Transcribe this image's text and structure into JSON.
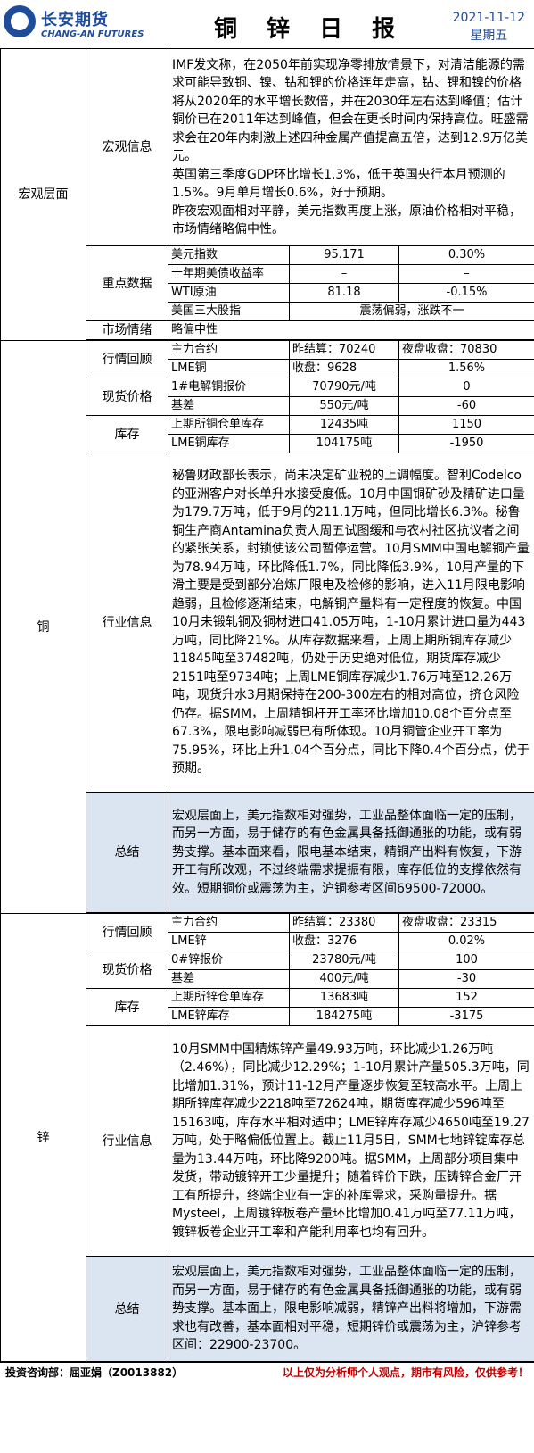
{
  "header": {
    "logo_cn": "长安期货",
    "logo_en": "CHANG-AN FUTURES",
    "title": "铜 锌 日 报",
    "date": "2021-11-12",
    "weekday": "星期五"
  },
  "macro": {
    "category": "宏观层面",
    "info_label": "宏观信息",
    "info_p1": "IMF发文称，在2050年前实现净零排放情景下，对清洁能源的需求可能导致铜、镍、钴和锂的价格连年走高，钴、锂和镍的价格将从2020年的水平增长数倍，并在2030年左右达到峰值；估计铜价已在2011年达到峰值，但会在更长时间内保持高位。旺盛需求会在20年内刺激上述四种金属产值提高五倍，达到12.9万亿美元。",
    "info_p2": "英国第三季度GDP环比增长1.3%，低于英国央行本月预测的1.5%。9月单月增长0.6%，好于预期。",
    "info_p3": "昨夜宏观面相对平静，美元指数再度上涨，原油价格相对平稳，市场情绪略偏中性。",
    "key_label": "重点数据",
    "key_rows": [
      {
        "name": "美元指数",
        "value": "95.171",
        "change": "0.30%"
      },
      {
        "name": "十年期美债收益率",
        "value": "–",
        "change": "–"
      },
      {
        "name": "WTI原油",
        "value": "81.18",
        "change": "-0.15%"
      }
    ],
    "stocks_name": "美国三大股指",
    "stocks_value": "震荡偏弱，涨跌不一",
    "sentiment_label": "市场情绪",
    "sentiment_value": "略偏中性"
  },
  "copper": {
    "category": "铜",
    "quote_label": "行情回顾",
    "main_contract": "主力合约",
    "main_settle": "昨结算：70240",
    "main_night": "夜盘收盘：70830",
    "lme_name": "LME铜",
    "lme_close": "收盘：9628",
    "lme_change": "1.56%",
    "spot_label": "现货价格",
    "spot_name": "1#电解铜报价",
    "spot_value": "70790元/吨",
    "spot_change": "0",
    "basis_name": "基差",
    "basis_value": "550元/吨",
    "basis_change": "-60",
    "inv_label": "库存",
    "shfe_inv_name": "上期所铜仓单库存",
    "shfe_inv_value": "12435吨",
    "shfe_inv_change": "1150",
    "lme_inv_name": "LME铜库存",
    "lme_inv_value": "104175吨",
    "lme_inv_change": "-1950",
    "industry_label": "行业信息",
    "industry_text": "秘鲁财政部长表示，尚未决定矿业税的上调幅度。智利Codelco的亚洲客户对长单升水接受度低。10月中国铜矿砂及精矿进口量为179.7万吨，低于9月的211.1万吨，但同比增长6.3%。秘鲁铜生产商Antamina负责人周五试图缓和与农村社区抗议者之间的紧张关系，封锁使该公司暂停运营。10月SMM中国电解铜产量为78.94万吨，环比降低1.7%，同比降低3.9%，10月产量的下滑主要是受到部分冶炼厂限电及检修的影响，进入11月限电影响趋弱，且检修逐渐结束，电解铜产量料有一定程度的恢复。中国10月未锻轧铜及铜材进口41.05万吨，1-10月累计进口量为443万吨，同比降21%。从库存数据来看，上周上期所铜库存减少11845吨至37482吨，仍处于历史绝对低位，期货库存减少2151吨至9734吨；上周LME铜库存减少1.76万吨至12.26万吨，现货升水3月期保持在200-300左右的相对高位，挤仓风险仍存。据SMM，上周精铜杆开工率环比增加10.08个百分点至67.3%，限电影响减弱已有所体现。10月铜管企业开工率为75.95%，环比上升1.04个百分点，同比下降0.4个百分点，优于预期。",
    "summary_label": "总结",
    "summary_text": "宏观层面上，美元指数相对强势，工业品整体面临一定的压制，而另一方面，易于储存的有色金属具备抵御通胀的功能，或有弱势支撑。基本面来看，限电基本结束，精铜产出料有恢复，下游开工有所改观，不过终端需求提振有限，库存低位的支撑依然有效。短期铜价或震荡为主，沪铜参考区间69500-72000。"
  },
  "zinc": {
    "category": "锌",
    "quote_label": "行情回顾",
    "main_contract": "主力合约",
    "main_settle": "昨结算：23380",
    "main_night": "夜盘收盘：23315",
    "lme_name": "LME锌",
    "lme_close": "收盘：3276",
    "lme_change": "0.02%",
    "spot_label": "现货价格",
    "spot_name": "0#锌报价",
    "spot_value": "23780元/吨",
    "spot_change": "100",
    "basis_name": "基差",
    "basis_value": "400元/吨",
    "basis_change": "-30",
    "inv_label": "库存",
    "shfe_inv_name": "上期所锌仓单库存",
    "shfe_inv_value": "13683吨",
    "shfe_inv_change": "152",
    "lme_inv_name": "LME锌库存",
    "lme_inv_value": "184275吨",
    "lme_inv_change": "-3175",
    "industry_label": "行业信息",
    "industry_text": "10月SMM中国精炼锌产量49.93万吨，环比减少1.26万吨（2.46%），同比减少12.29%；1-10月累计产量505.3万吨，同比增加1.31%，预计11-12月产量逐步恢复至较高水平。上周上期所锌库存减少2218吨至72624吨，期货库存减少596吨至15163吨，库存水平相对适中；LME锌库存减少4650吨至19.27万吨，处于略偏低位置上。截止11月5日，SMM七地锌锭库存总量为13.44万吨，环比降9200吨。据SMM，上周部分项目集中发货，带动镀锌开工少量提升；随着锌价下跌，压铸锌合金厂开工有所提升，终端企业有一定的补库需求，采购量提升。据Mysteel，上周镀锌板卷产量环比增加0.41万吨至77.11万吨，镀锌板卷企业开工率和产能利用率也均有回升。",
    "summary_label": "总结",
    "summary_text": "宏观层面上，美元指数相对强势，工业品整体面临一定的压制，而另一方面，易于储存的有色金属具备抵御通胀的功能，或有弱势支撑。基本面上，限电影响减弱，精锌产出料将增加，下游需求也有改善，基本面相对平稳，短期锌价或震荡为主，沪锌参考区间：22900-23700。"
  },
  "footer": {
    "consultant": "投资咨询部：屈亚娟（Z0013882）",
    "disclaimer": "以上仅为分析师个人观点，期市有风险，仅供参考！"
  },
  "colors": {
    "brand": "#1e4c9a",
    "summary_bg": "#dbe5f1",
    "disclaimer": "#c00000"
  }
}
